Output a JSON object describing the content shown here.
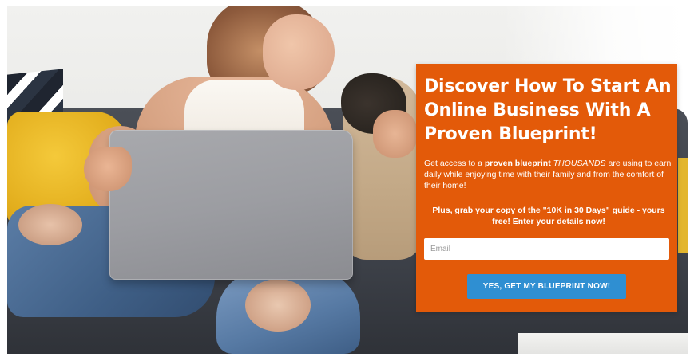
{
  "optin": {
    "headline": "Discover How To Start An Online Business With A Proven Blueprint!",
    "description": {
      "part1": "Get access to a ",
      "bold": "proven blueprint",
      "part2": " ",
      "italic": "THOUSANDS",
      "part3": " are using to earn daily while enjoying time with their family and from the comfort of their home!"
    },
    "offer": "Plus, grab your copy of the \"10K in 30 Days\" guide - yours free! Enter your details now!",
    "email": {
      "placeholder": "Email",
      "value": ""
    },
    "cta_label": "YES, GET MY BLUEPRINT NOW!"
  },
  "colors": {
    "panel": "#e35a09",
    "button": "#2f8fd2",
    "text": "#ffffff"
  },
  "background": {
    "description_icon": "photo-woman-laptop-dog-icon"
  }
}
